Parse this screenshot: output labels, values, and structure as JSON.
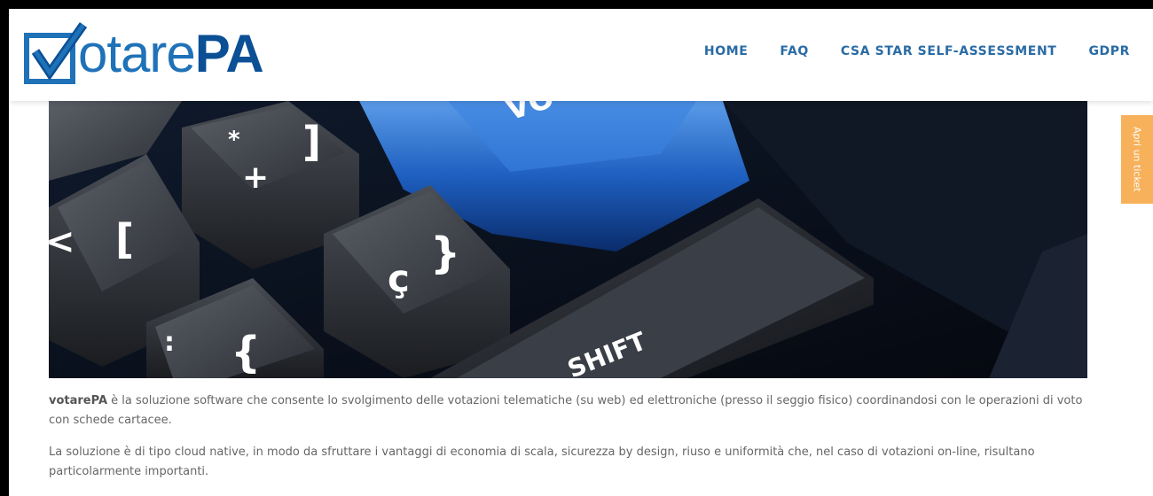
{
  "header": {
    "logo": {
      "part1": "otare",
      "part2": "PA"
    },
    "nav": [
      {
        "label": "HOME"
      },
      {
        "label": "FAQ"
      },
      {
        "label": "CSA STAR SELF-ASSESSMENT"
      },
      {
        "label": "GDPR"
      }
    ]
  },
  "hero": {
    "keys": {
      "star": "*",
      "bracket_right": "]",
      "plus": "+",
      "bracket_left": "[",
      "less": "<",
      "cedilla": "ç",
      "brace_right": "}",
      "brace_left": "{",
      "colon": ":",
      "shift": "SHIFT",
      "vo": "VO"
    }
  },
  "content": {
    "p1_strong": "votarePA",
    "p1_text": " è la soluzione software che consente lo svolgimento delle votazioni telematiche (su web) ed elettroniche (presso il seggio fisico) coordinandosi con le operazioni di voto con schede cartacee.",
    "p2_text": "La soluzione è di tipo cloud native, in modo da sfruttare i vantaggi di economia di scala, sicurezza by design, riuso e uniformità che, nel caso di votazioni on-line, risultano particolarmente importanti."
  },
  "ticket": {
    "label": "Apri un ticket"
  },
  "colors": {
    "brand_blue": "#1f72b8",
    "brand_dark": "#0b4f95",
    "nav_text": "#2a6ba4",
    "ticket_bg": "#f7b15a"
  }
}
